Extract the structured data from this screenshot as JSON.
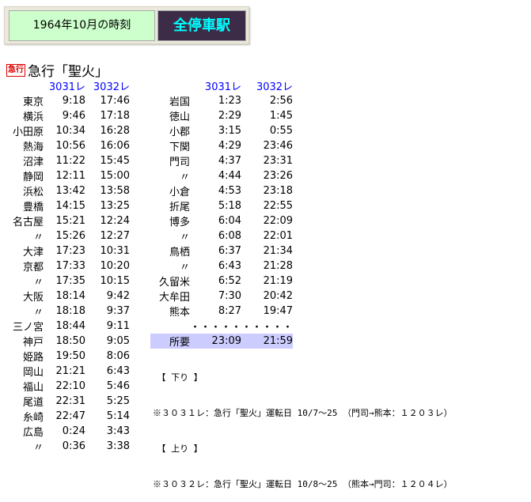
{
  "header": {
    "period": "1964年10月の時刻",
    "mode": "全停車駅"
  },
  "train": {
    "badge": "急行",
    "name": "急行「聖火」"
  },
  "columns": [
    "3031レ",
    "3032レ"
  ],
  "left_rows": [
    [
      "東京",
      "9:18",
      "17:46"
    ],
    [
      "横浜",
      "9:46",
      "17:18"
    ],
    [
      "小田原",
      "10:34",
      "16:28"
    ],
    [
      "熱海",
      "10:56",
      "16:06"
    ],
    [
      "沼津",
      "11:22",
      "15:45"
    ],
    [
      "静岡",
      "12:11",
      "15:00"
    ],
    [
      "浜松",
      "13:42",
      "13:58"
    ],
    [
      "豊橋",
      "14:15",
      "13:25"
    ],
    [
      "名古屋",
      "15:21",
      "12:24"
    ],
    [
      "〃",
      "15:26",
      "12:27"
    ],
    [
      "大津",
      "17:23",
      "10:31"
    ],
    [
      "京都",
      "17:33",
      "10:20"
    ],
    [
      "〃",
      "17:35",
      "10:15"
    ],
    [
      "大阪",
      "18:14",
      "9:42"
    ],
    [
      "〃",
      "18:18",
      "9:37"
    ],
    [
      "三ノ宮",
      "18:44",
      "9:11"
    ],
    [
      "神戸",
      "18:50",
      "9:05"
    ],
    [
      "姫路",
      "19:50",
      "8:06"
    ],
    [
      "岡山",
      "21:21",
      "6:43"
    ],
    [
      "福山",
      "22:10",
      "5:46"
    ],
    [
      "尾道",
      "22:31",
      "5:25"
    ],
    [
      "糸崎",
      "22:47",
      "5:14"
    ],
    [
      "広島",
      "0:24",
      "3:43"
    ],
    [
      "〃",
      "0:36",
      "3:38"
    ]
  ],
  "right_rows": [
    [
      "岩国",
      "1:23",
      "2:56"
    ],
    [
      "徳山",
      "2:29",
      "1:45"
    ],
    [
      "小郡",
      "3:15",
      "0:55"
    ],
    [
      "下関",
      "4:29",
      "23:46"
    ],
    [
      "門司",
      "4:37",
      "23:31"
    ],
    [
      "〃",
      "4:44",
      "23:26"
    ],
    [
      "小倉",
      "4:53",
      "23:18"
    ],
    [
      "折尾",
      "5:18",
      "22:55"
    ],
    [
      "博多",
      "6:04",
      "22:09"
    ],
    [
      "〃",
      "6:08",
      "22:01"
    ],
    [
      "鳥栖",
      "6:37",
      "21:34"
    ],
    [
      "〃",
      "6:43",
      "21:28"
    ],
    [
      "久留米",
      "6:52",
      "21:19"
    ],
    [
      "大牟田",
      "7:30",
      "20:42"
    ],
    [
      "熊本",
      "8:27",
      "19:47"
    ],
    [
      "",
      "・・・・・",
      "・・・・・"
    ]
  ],
  "total": {
    "label": "所要",
    "a": "23:09",
    "b": "21:59"
  },
  "notes": [
    "　【 下り 】",
    "※３０３１レ：急行「聖火」運転日 10/7〜25 （門司→熊本：１２０３レ）",
    "　【 上り 】",
    "※３０３２レ：急行「聖火」運転日 10/8〜25 （熊本→門司：１２０４レ）"
  ],
  "colors": {
    "header_bg": "#ccffcc",
    "mode_bg": "#3d2c48",
    "mode_text": "#00ffff",
    "column_header": "#0000ff",
    "total_bg": "#ccccff"
  }
}
